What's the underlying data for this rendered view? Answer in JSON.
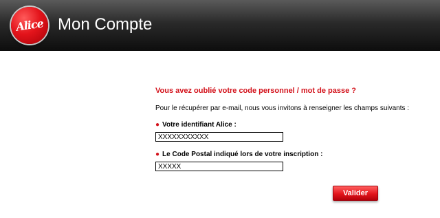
{
  "header": {
    "logo_text": "Alice",
    "title": "Mon Compte"
  },
  "form": {
    "heading": "Vous avez oublié votre code personnel / mot de passe ?",
    "instructions": "Pour le récupérer par e-mail, nous vous invitons à renseigner les champs suivants :",
    "bullet": "●",
    "fields": [
      {
        "label": "Votre identifiant Alice :",
        "value": "XXXXXXXXXXX"
      },
      {
        "label": "Le Code Postal indiqué lors de votre inscription :",
        "value": "XXXXX"
      }
    ],
    "submit_label": "Valider"
  },
  "colors": {
    "accent": "#d3121b",
    "header_bg": "#1a1a1a"
  }
}
